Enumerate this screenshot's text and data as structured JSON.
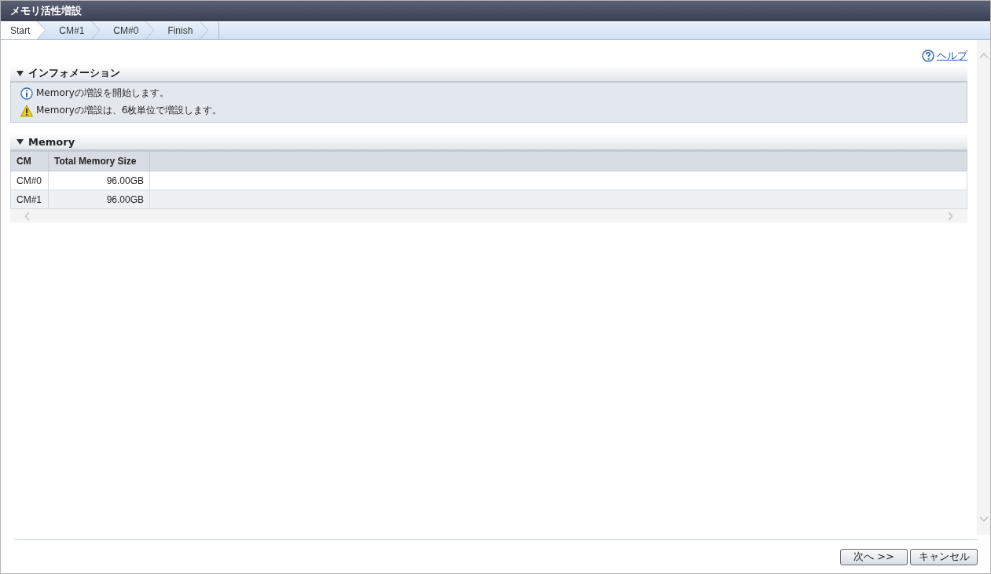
{
  "window": {
    "title": "メモリ活性増設"
  },
  "steps": [
    {
      "label": "Start",
      "selected": true
    },
    {
      "label": "CM#1",
      "selected": false
    },
    {
      "label": "CM#0",
      "selected": false
    },
    {
      "label": "Finish",
      "selected": false
    }
  ],
  "help_link": "ヘルプ",
  "information": {
    "title": "インフォメーション",
    "expanded": true,
    "messages": [
      {
        "kind": "info",
        "text": "Memoryの増設を開始します。"
      },
      {
        "kind": "warning",
        "text": "Memoryの増設は、6枚単位で増設します。"
      }
    ]
  },
  "memory": {
    "title": "Memory",
    "expanded": true,
    "columns": [
      "CM",
      "Total Memory Size"
    ],
    "rows": [
      [
        "CM#0",
        "96.00GB"
      ],
      [
        "CM#1",
        "96.00GB"
      ]
    ]
  },
  "buttons": [
    "次へ >>",
    "キャンセル"
  ]
}
